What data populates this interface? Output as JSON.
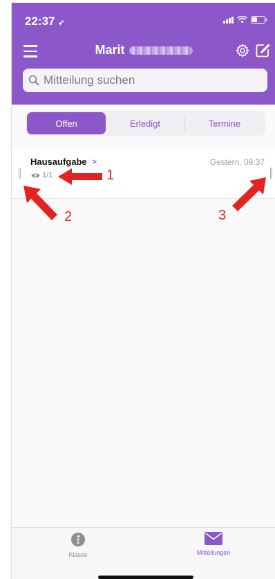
{
  "status_bar": {
    "time": "22:37",
    "location_icon": "location-arrow-icon",
    "signal_icon": "cellular-signal-icon",
    "wifi_icon": "wifi-icon",
    "battery_icon": "battery-icon"
  },
  "header": {
    "title": "Marit",
    "menu_icon": "hamburger-menu-icon",
    "settings_icon": "gear-icon",
    "compose_icon": "compose-icon",
    "background_color": "#8c57c8"
  },
  "search": {
    "placeholder": "Mitteilung suchen",
    "icon": "search-icon"
  },
  "segments": {
    "items": [
      {
        "label": "Offen",
        "active": true
      },
      {
        "label": "Erledigt",
        "active": false
      },
      {
        "label": "Termine",
        "active": false
      }
    ]
  },
  "messages": [
    {
      "title": "Hausaufgabe",
      "arrow": ">",
      "views": "1/1",
      "timestamp": "Gestern, 09:37"
    }
  ],
  "annotations": {
    "labels": [
      "1",
      "2",
      "3"
    ],
    "color": "#e32222"
  },
  "tabbar": {
    "items": [
      {
        "label": "Klasse",
        "icon": "info-icon",
        "active": false
      },
      {
        "label": "Mitteilungen",
        "icon": "envelope-icon",
        "active": true
      }
    ]
  }
}
